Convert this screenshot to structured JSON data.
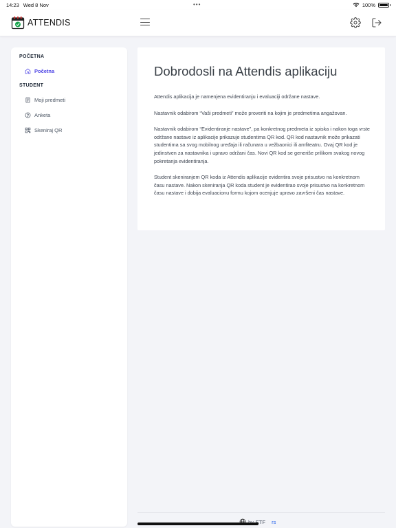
{
  "status_bar": {
    "time": "14:23",
    "date": "Wed 8 Nov",
    "dots": "•••",
    "battery": "100%",
    "battery_level": 1.0
  },
  "header": {
    "logo_text": "ATTENDIS",
    "icons": [
      "calendar-check-icon",
      "hamburger-icon",
      "gear-icon",
      "logout-icon"
    ]
  },
  "sidebar": {
    "sections": [
      {
        "title": "POČETNA",
        "items": [
          {
            "label": "Početna",
            "icon": "home-icon",
            "active": true
          }
        ]
      },
      {
        "title": "STUDENT",
        "items": [
          {
            "label": "Moji predmeti",
            "icon": "document-icon",
            "active": false
          },
          {
            "label": "Anketa",
            "icon": "question-icon",
            "active": false
          },
          {
            "label": "Skeniraj QR",
            "icon": "qr-icon",
            "active": false
          }
        ]
      }
    ]
  },
  "main": {
    "title": "Dobrodosli na Attendis aplikaciju",
    "paragraphs": [
      "Attendis aplikacija je namenjena evidentiranju i evaluaciji održane nastave.",
      "Nastavnik odabirom “Vaši predmeti” može proveriti na kojim je predmetima angažovan.",
      "Nastavnik odabirom “Evidentiranje nastave”, pa konkretnog predmeta iz spiska i nakon toga vrste održane nastave iz aplikacije prikazuje studentima QR kod. QR kod nastavnik može prikazati studentima sa svog mobilnog uređaja ili računara u vežbaonici ili amfiteatru. Ovaj QR kod je jedinstven za nastavnika i upravo održani čas. Novi QR kod se generiše prilikom svakog novog pokretanja evidentiranja.",
      "Student skeniranjem QR koda iz Attendis aplikacije evidentira svoje prisustvo na konkretnom času nastave. Nakon skeniranja QR koda student je evidentirao svoje prisustvo na konkretnom času nastave i dobija evaluacionu formu kojom ocenjuje upravo završeni čas nastave."
    ]
  },
  "footer": {
    "by": "by",
    "etf": "ETF",
    "rs": "rs"
  },
  "colors": {
    "accent": "#4f46e5",
    "background": "#f3f4f8",
    "logo_green": "#16a34a",
    "logo_red": "#dc2626"
  }
}
